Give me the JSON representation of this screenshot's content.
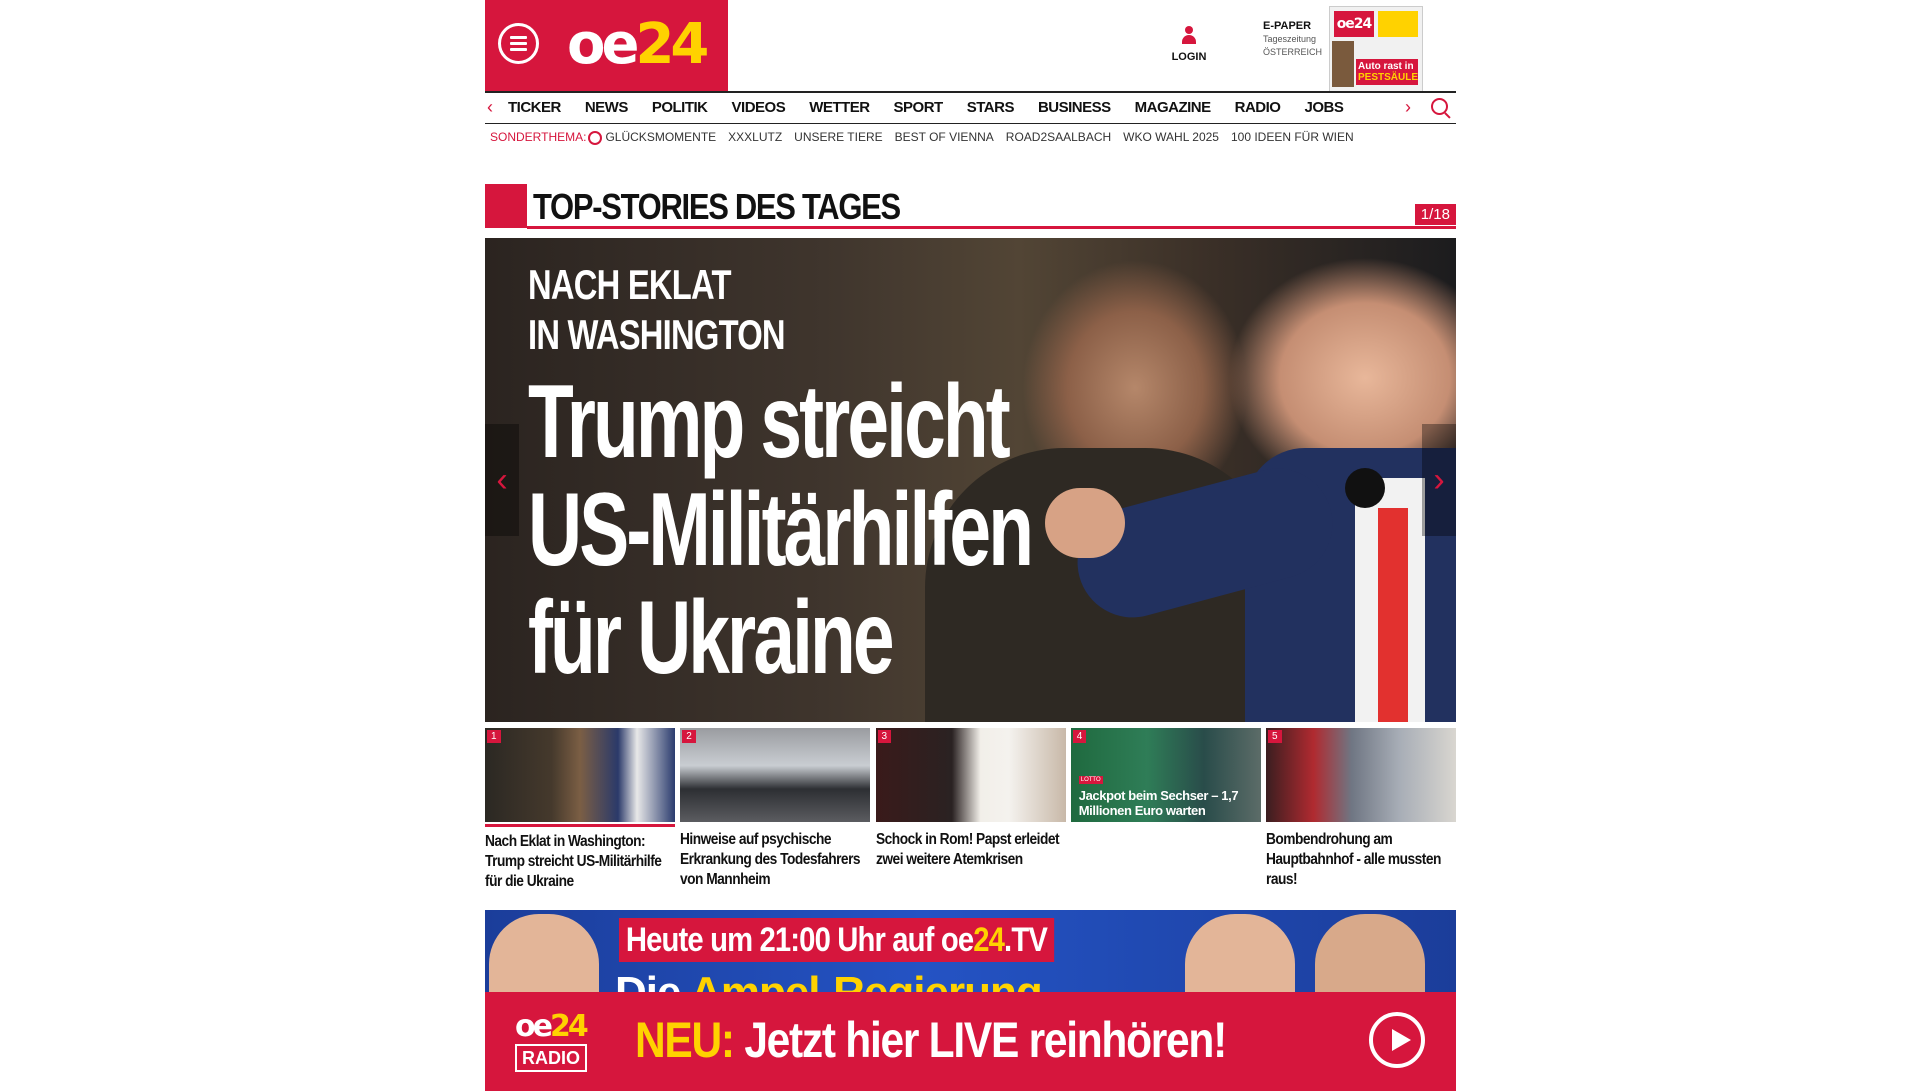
{
  "brand": {
    "logo_text_main": "oe",
    "logo_text_accent": "24",
    "accent_color": "#d6163d",
    "highlight_color": "#ffd200"
  },
  "header": {
    "menu_icon": "hamburger-menu-icon",
    "login_label": "LOGIN",
    "epaper": {
      "title": "E-PAPER",
      "line2": "Tageszeitung",
      "line3": "ÖSTERREICH",
      "cover_logo": "oe24",
      "cover_headline_1": "Auto rast in",
      "cover_headline_2": "PESTSÄULE"
    }
  },
  "nav": {
    "items": [
      "TICKER",
      "NEWS",
      "POLITIK",
      "VIDEOS",
      "WETTER",
      "SPORT",
      "STARS",
      "BUSINESS",
      "MAGAZINE",
      "RADIO",
      "JOBS"
    ],
    "prev_arrow": "‹",
    "next_arrow": "›"
  },
  "subnav": {
    "label": "SONDERTHEMA:",
    "items": [
      "GLÜCKSMOMENTE",
      "XXXLUTZ",
      "UNSERE TIERE",
      "BEST OF VIENNA",
      "ROAD2SAALBACH",
      "WKO WAHL 2025",
      "100 IDEEN FÜR WIEN"
    ]
  },
  "section": {
    "title": "TOP-STORIES DES TAGES",
    "counter": "1/18"
  },
  "hero": {
    "kicker_line1": "NACH EKLAT",
    "kicker_line2": "IN WASHINGTON",
    "headline_line1": "Trump streicht",
    "headline_line2": "US-Militärhilfen",
    "headline_line3": "für Ukraine",
    "prev_arrow": "‹",
    "next_arrow": "›"
  },
  "teasers": [
    {
      "num": "1",
      "title": "Nach Eklat in Washington: Trump streicht US-Militärhilfe für die Ukraine"
    },
    {
      "num": "2",
      "title": "Hinweise auf psychische Erkrankung des Todesfahrers von Mannheim"
    },
    {
      "num": "3",
      "title": "Schock in Rom! Papst erleidet zwei weitere Atemkrisen"
    },
    {
      "num": "4",
      "title": "Jackpot beim Sechser – 1,7 Millionen Euro warten",
      "image_overlay": "Jackpot beim Sechser – 1,7 Millionen Euro warten",
      "badge": "LOTTO"
    },
    {
      "num": "5",
      "title": "Bombendrohung am Hauptbahnhof - alle mussten raus!"
    }
  ],
  "tv_banner": {
    "line1_prefix": "Heute um 21:00 Uhr auf ",
    "line1_brand_main": "oe",
    "line1_brand_accent": "24",
    "line1_suffix": ".TV",
    "line2_prefix": "Die ",
    "line2_accent": "Ampel-Regierung"
  },
  "radio_bar": {
    "logo_top_main": "oe",
    "logo_top_accent": "24",
    "logo_bottom": "RADIO",
    "neu": "NEU:",
    "text": " Jetzt hier LIVE reinhören!",
    "play_icon": "play-icon"
  }
}
